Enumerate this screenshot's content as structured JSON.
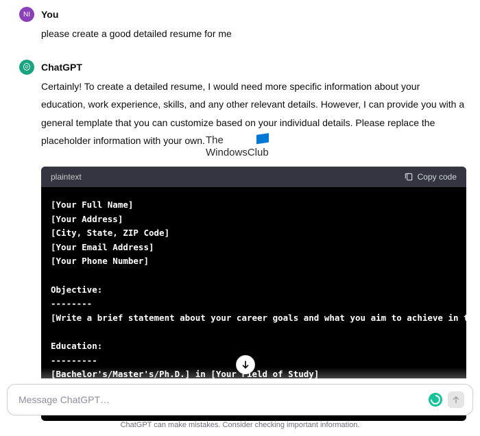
{
  "user_message": {
    "sender": "You",
    "avatar_initials": "NI",
    "text": "please create a good detailed resume for me"
  },
  "assistant_message": {
    "sender": "ChatGPT",
    "text": "Certainly! To create a detailed resume, I would need more specific information about your education, work experience, skills, and any other relevant details. However, I can provide you with a general template that you can customize based on your individual details. Please replace the placeholder information with your own."
  },
  "code_block": {
    "language": "plaintext",
    "copy_label": "Copy code",
    "content": "[Your Full Name]\n[Your Address]\n[City, State, ZIP Code]\n[Your Email Address]\n[Your Phone Number]\n\nObjective:\n--------\n[Write a brief statement about your career goals and what you aim to achieve in the d\n\nEducation:\n---------\n[Bachelor's/Master's/Ph.D.] in [Your Field of Study]\n[University Name], [Location]\n[Month and Year of Graduation]"
  },
  "watermark": {
    "line1": "The",
    "line2": "WindowsClub"
  },
  "input": {
    "placeholder": "Message ChatGPT…"
  },
  "disclaimer": "ChatGPT can make mistakes. Consider checking important information."
}
